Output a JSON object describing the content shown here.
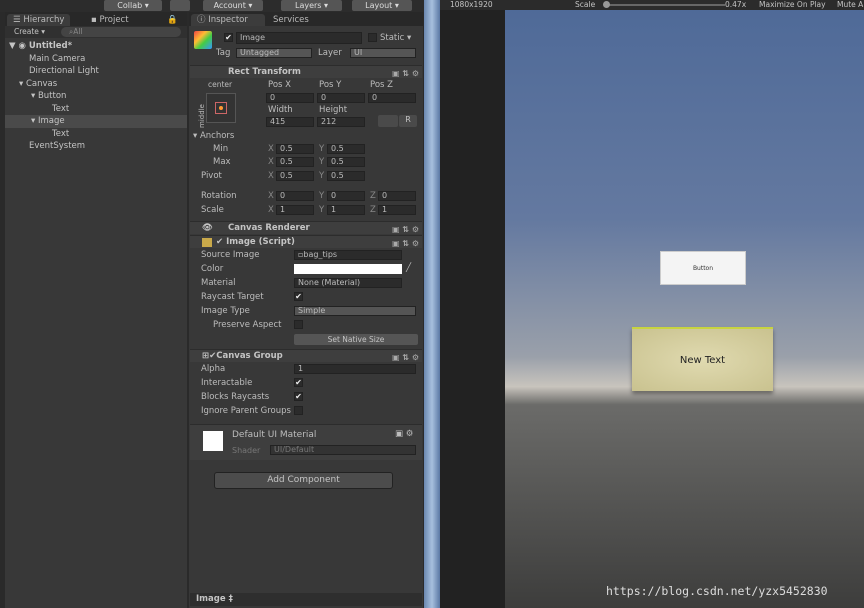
{
  "toolbar": {
    "collab": "Collab ▾",
    "account": "Account ▾",
    "layers": "Layers ▾",
    "layout": "Layout ▾"
  },
  "hierarchy": {
    "tab": "Hierarchy",
    "tab2": "Project",
    "create": "Create ▾",
    "search_placeholder": "All",
    "scene": "Untitled*",
    "items": [
      {
        "label": "Main Camera"
      },
      {
        "label": "Directional Light"
      },
      {
        "label": "Canvas"
      },
      {
        "label": "Button"
      },
      {
        "label": "Text"
      },
      {
        "label": "Image"
      },
      {
        "label": "Text"
      },
      {
        "label": "EventSystem"
      }
    ]
  },
  "inspector": {
    "tab": "Inspector",
    "tab2": "Services",
    "name": "Image",
    "static": "Static",
    "tag_label": "Tag",
    "tag": "Untagged",
    "layer_label": "Layer",
    "layer": "UI",
    "rect": {
      "title": "Rect Transform",
      "anchor_h": "center",
      "anchor_v": "middle",
      "posx": "Pos X",
      "posy": "Pos Y",
      "posz": "Pos Z",
      "vx": "0",
      "vy": "0",
      "vz": "0",
      "width_label": "Width",
      "height_label": "Height",
      "width": "415",
      "height": "212",
      "r": "R",
      "anchors": "Anchors",
      "min": "Min",
      "max": "Max",
      "pivot": "Pivot",
      "min_x": "0.5",
      "min_y": "0.5",
      "max_x": "0.5",
      "max_y": "0.5",
      "pivot_x": "0.5",
      "pivot_y": "0.5",
      "rotation": "Rotation",
      "scale": "Scale",
      "rot_x": "0",
      "rot_y": "0",
      "rot_z": "0",
      "sc_x": "1",
      "sc_y": "1",
      "sc_z": "1",
      "X": "X",
      "Y": "Y",
      "Z": "Z"
    },
    "canvas_renderer": "Canvas Renderer",
    "image": {
      "title": "Image (Script)",
      "source_label": "Source Image",
      "source": "bag_tips",
      "color_label": "Color",
      "material_label": "Material",
      "material": "None (Material)",
      "raycast_label": "Raycast Target",
      "type_label": "Image Type",
      "type": "Simple",
      "preserve_label": "Preserve Aspect",
      "native": "Set Native Size"
    },
    "canvas_group": {
      "title": "Canvas Group",
      "alpha_label": "Alpha",
      "alpha": "1",
      "interactable": "Interactable",
      "blocks": "Blocks Raycasts",
      "ignore": "Ignore Parent Groups"
    },
    "material": {
      "title": "Default UI Material",
      "shader_label": "Shader",
      "shader": "UI/Default"
    },
    "add_component": "Add Component",
    "footer": "Image ‡"
  },
  "game": {
    "resolution": "1080x1920",
    "scale_label": "Scale",
    "scale": "0.47x",
    "maximize": "Maximize On Play",
    "mute": "Mute A",
    "button_text": "Button",
    "image_text": "New Text"
  },
  "watermark": "https://blog.csdn.net/yzx5452830"
}
